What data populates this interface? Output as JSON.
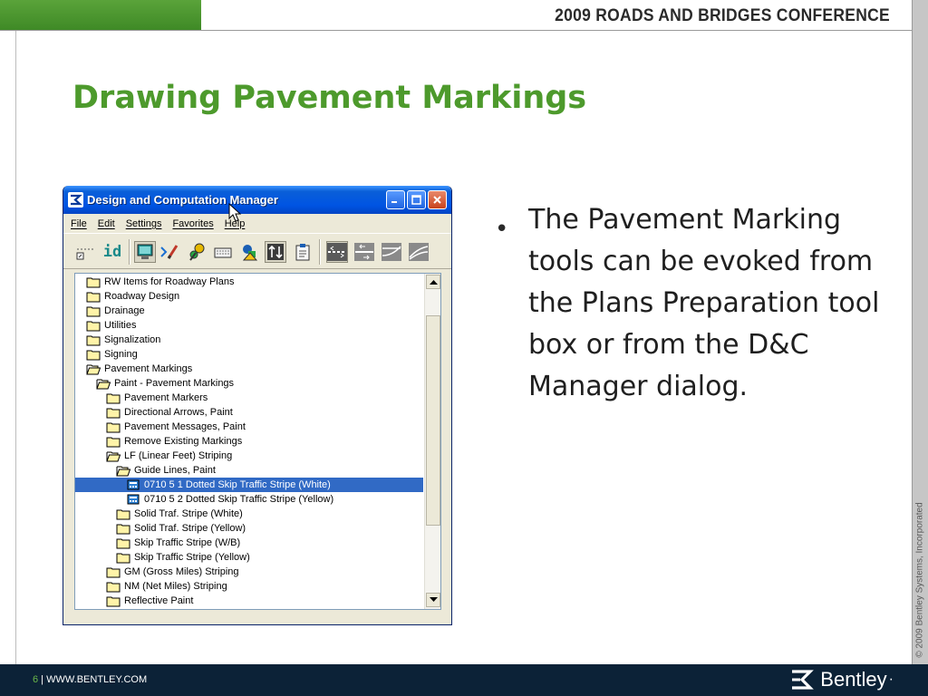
{
  "slide": {
    "conference": "2009 ROADS AND BRIDGES CONFERENCE",
    "title": "Drawing Pavement Markings",
    "bullet": "The Pavement Marking tools can be evoked from the Plans Preparation tool box or from the D&C Manager dialog.",
    "copyright": "© 2009 Bentley Systems, Incorporated",
    "footer": {
      "page": "6",
      "separator": " | ",
      "url": "WWW.BENTLEY.COM",
      "logo": "Bentley",
      "logo_mark": "·"
    },
    "colors": {
      "accent_green": "#4d9a2c",
      "footer_navy": "#0c2237"
    }
  },
  "window": {
    "title": "Design and Computation Manager",
    "menu": [
      "File",
      "Edit",
      "Settings",
      "Favorites",
      "Help"
    ],
    "toolbar_id_label": "id",
    "toolbar_icons": [
      "line-style-icon",
      "id-icon",
      "monitor-icon",
      "pencil-check-icon",
      "paint-icon",
      "keyboard-icon",
      "shapes-icon",
      "arrows-updown-icon",
      "clipboard-icon",
      "stripe-dash-icon",
      "stripe-arrows-icon",
      "stripe-curve-icon",
      "stripe-skew-icon"
    ],
    "selection_color": "#316ac5",
    "tree": [
      {
        "label": "RW Items for Roadway Plans",
        "indent": 0,
        "icon": "folder-closed-icon"
      },
      {
        "label": "Roadway Design",
        "indent": 0,
        "icon": "folder-closed-icon"
      },
      {
        "label": "Drainage",
        "indent": 0,
        "icon": "folder-closed-icon"
      },
      {
        "label": "Utilities",
        "indent": 0,
        "icon": "folder-closed-icon"
      },
      {
        "label": "Signalization",
        "indent": 0,
        "icon": "folder-closed-icon"
      },
      {
        "label": "Signing",
        "indent": 0,
        "icon": "folder-closed-icon"
      },
      {
        "label": "Pavement Markings",
        "indent": 0,
        "icon": "folder-open-icon"
      },
      {
        "label": "Paint - Pavement Markings",
        "indent": 1,
        "icon": "folder-open-icon"
      },
      {
        "label": "Pavement Markers",
        "indent": 2,
        "icon": "folder-closed-icon"
      },
      {
        "label": "Directional Arrows, Paint",
        "indent": 2,
        "icon": "folder-closed-icon"
      },
      {
        "label": "Pavement Messages, Paint",
        "indent": 2,
        "icon": "folder-closed-icon"
      },
      {
        "label": "Remove Existing Markings",
        "indent": 2,
        "icon": "folder-closed-icon"
      },
      {
        "label": "LF  (Linear Feet) Striping",
        "indent": 2,
        "icon": "folder-open-icon"
      },
      {
        "label": "Guide Lines, Paint",
        "indent": 3,
        "icon": "folder-open-icon"
      },
      {
        "label": "0710  5  1 Dotted Skip Traffic Stripe (White)",
        "indent": 4,
        "icon": "item-icon",
        "selected": true
      },
      {
        "label": "0710  5  2 Dotted Skip Traffic Stripe (Yellow)",
        "indent": 4,
        "icon": "item-icon"
      },
      {
        "label": "Solid Traf. Stripe (White)",
        "indent": 3,
        "icon": "folder-closed-icon"
      },
      {
        "label": "Solid Traf. Stripe (Yellow)",
        "indent": 3,
        "icon": "folder-closed-icon"
      },
      {
        "label": "Skip Traffic Stripe (W/B)",
        "indent": 3,
        "icon": "folder-closed-icon"
      },
      {
        "label": "Skip Traffic Stripe (Yellow)",
        "indent": 3,
        "icon": "folder-closed-icon"
      },
      {
        "label": "GM (Gross Miles) Striping",
        "indent": 2,
        "icon": "folder-closed-icon"
      },
      {
        "label": "NM (Net Miles) Striping",
        "indent": 2,
        "icon": "folder-closed-icon"
      },
      {
        "label": "Reflective Paint",
        "indent": 2,
        "icon": "folder-closed-icon"
      }
    ]
  }
}
